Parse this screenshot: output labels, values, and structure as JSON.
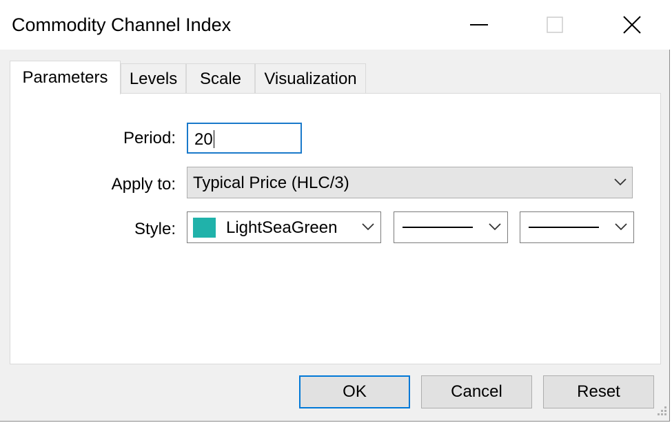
{
  "window": {
    "title": "Commodity Channel Index"
  },
  "tabs": [
    {
      "label": "Parameters",
      "active": true
    },
    {
      "label": "Levels",
      "active": false
    },
    {
      "label": "Scale",
      "active": false
    },
    {
      "label": "Visualization",
      "active": false
    }
  ],
  "params": {
    "period_label": "Period:",
    "period_value": "20",
    "apply_label": "Apply to:",
    "apply_value": "Typical Price (HLC/3)",
    "style_label": "Style:",
    "color_name": "LightSeaGreen",
    "color_hex": "#20b2aa"
  },
  "buttons": {
    "ok": "OK",
    "cancel": "Cancel",
    "reset": "Reset"
  }
}
